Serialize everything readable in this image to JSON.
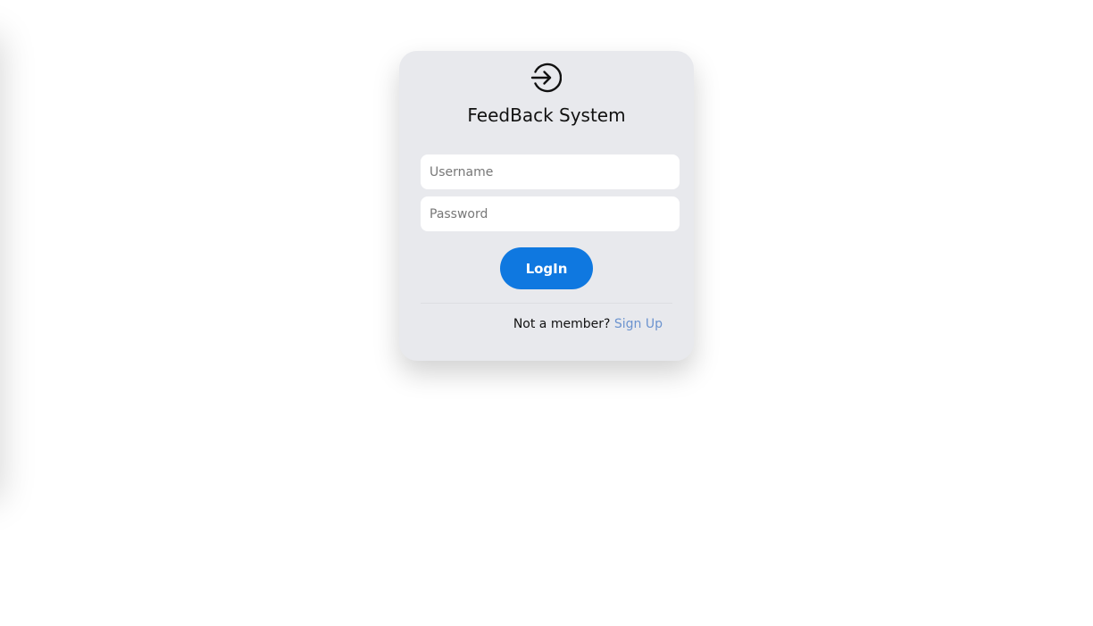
{
  "app": {
    "title": "FeedBack System"
  },
  "icons": {
    "login": "login-circle-arrow-icon"
  },
  "form": {
    "username_placeholder": "Username",
    "username_value": "",
    "password_placeholder": "Password",
    "password_value": "",
    "login_label": "LogIn"
  },
  "footer": {
    "prompt_text": "Not a member?",
    "signup_label": "Sign Up"
  },
  "colors": {
    "card_background": "#e8e9ed",
    "primary_button": "#0f78e0",
    "link": "#6b93cf"
  }
}
